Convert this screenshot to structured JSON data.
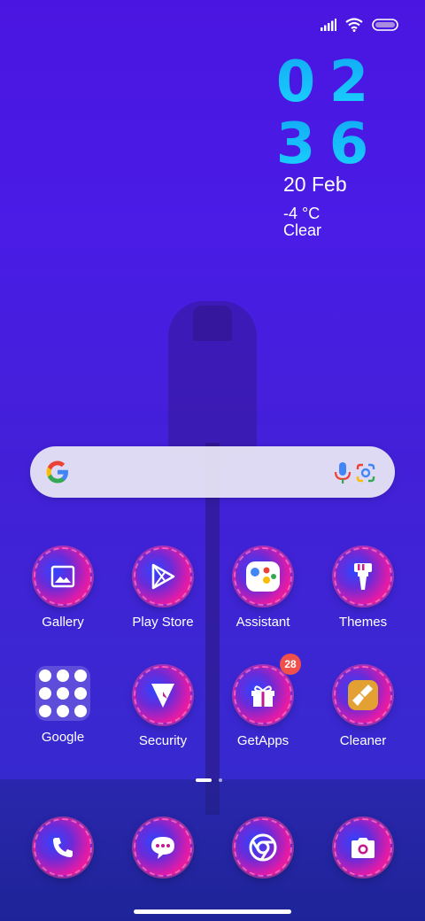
{
  "status_bar": {
    "signal_icon": "signal-icon",
    "wifi_icon": "wifi-icon",
    "battery_icon": "battery-icon"
  },
  "clock": {
    "hours": [
      "0",
      "2"
    ],
    "minutes": [
      "3",
      "6"
    ]
  },
  "date": "20 Feb",
  "weather": {
    "temperature": "-4 °C",
    "condition": "Clear"
  },
  "search": {
    "google_icon": "google-g-icon",
    "mic_icon": "mic-icon",
    "lens_icon": "lens-icon"
  },
  "apps": {
    "gallery": "Gallery",
    "play_store": "Play Store",
    "assistant": "Assistant",
    "themes": "Themes",
    "google": "Google",
    "security": "Security",
    "getapps": "GetApps",
    "getapps_badge": "28",
    "cleaner": "Cleaner"
  },
  "dock": [
    "phone-icon",
    "messages-icon",
    "chrome-icon",
    "camera-icon"
  ],
  "colors": {
    "accent_clock": "#1ad3ff",
    "badge": "#f0504a",
    "icon_pink": "#e11aa8",
    "icon_blue": "#2f44ff"
  }
}
